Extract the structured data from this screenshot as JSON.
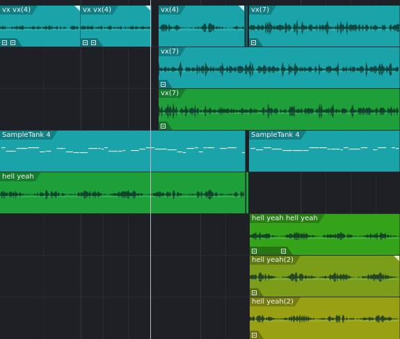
{
  "tracks": [
    {
      "clips": [
        {
          "label": "vx"
        },
        {
          "label": "vx(4)"
        },
        {
          "label": "vx"
        },
        {
          "label": "vx(4)"
        },
        {
          "label": "vx(4)"
        },
        {
          "label": "vx(7)"
        }
      ]
    },
    {
      "clips": [
        {
          "label": "vx(7)"
        }
      ]
    },
    {
      "clips": [
        {
          "label": "vx(7)"
        }
      ]
    },
    {
      "clips": [
        {
          "label": "SampleTank 4"
        },
        {
          "label": "SampleTank 4"
        }
      ]
    },
    {
      "clips": [
        {
          "label": "hell yeah"
        }
      ]
    },
    {
      "clips": [
        {
          "label": "hell yeah"
        },
        {
          "label": "hell yeah"
        }
      ]
    },
    {
      "clips": [
        {
          "label": "hell yeah(2)"
        }
      ]
    },
    {
      "clips": [
        {
          "label": "hell yeah(2)"
        }
      ]
    }
  ],
  "colors": {
    "teal": "#1aa3a8",
    "green": "#1e9f3a",
    "lime": "#35a31a",
    "olive1": "#7b9d19",
    "olive2": "#9aa014",
    "background": "#1f2026",
    "playhead": "#b9bcc4"
  },
  "icons": [
    "fx-icon",
    "clip-end-marker",
    "playhead"
  ]
}
